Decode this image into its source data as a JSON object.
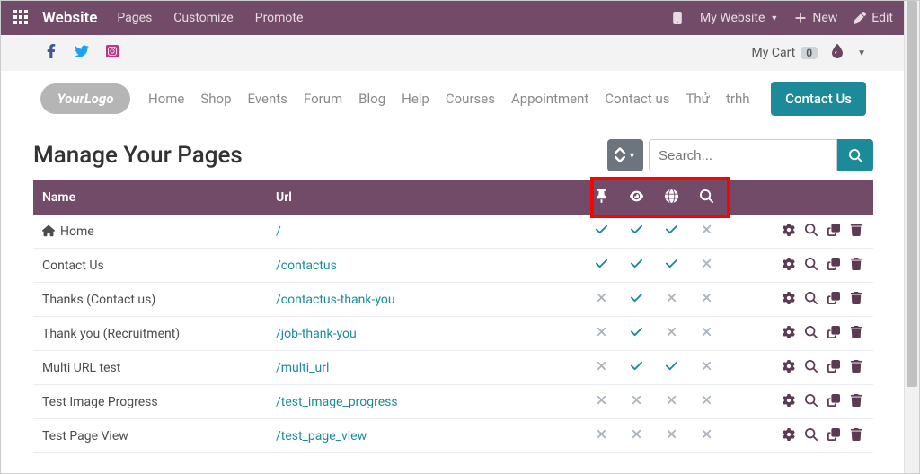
{
  "topbar": {
    "brand": "Website",
    "menu": [
      "Pages",
      "Customize",
      "Promote"
    ],
    "site_selector": "My Website",
    "new_label": "New",
    "edit_label": "Edit"
  },
  "subheader": {
    "cart_label": "My Cart",
    "cart_count": "0"
  },
  "sitenav": {
    "items": [
      "Home",
      "Shop",
      "Events",
      "Forum",
      "Blog",
      "Help",
      "Courses",
      "Appointment",
      "Contact us",
      "Thử",
      "trhh"
    ],
    "contact_btn": "Contact Us"
  },
  "page": {
    "title": "Manage Your Pages",
    "search_placeholder": "Search..."
  },
  "table": {
    "headers": {
      "name": "Name",
      "url": "Url"
    },
    "rows": [
      {
        "name": "Home",
        "url": "/",
        "home": true,
        "flags": [
          true,
          true,
          true,
          false
        ]
      },
      {
        "name": "Contact Us",
        "url": "/contactus",
        "flags": [
          true,
          true,
          true,
          false
        ]
      },
      {
        "name": "Thanks (Contact us)",
        "url": "/contactus-thank-you",
        "flags": [
          false,
          true,
          false,
          false
        ]
      },
      {
        "name": "Thank you (Recruitment)",
        "url": "/job-thank-you",
        "flags": [
          false,
          true,
          false,
          false
        ]
      },
      {
        "name": "Multi URL test",
        "url": "/multi_url",
        "flags": [
          false,
          true,
          true,
          false
        ]
      },
      {
        "name": "Test Image Progress",
        "url": "/test_image_progress",
        "flags": [
          false,
          false,
          false,
          false
        ]
      },
      {
        "name": "Test Page View",
        "url": "/test_page_view",
        "flags": [
          false,
          false,
          false,
          false
        ]
      }
    ]
  }
}
